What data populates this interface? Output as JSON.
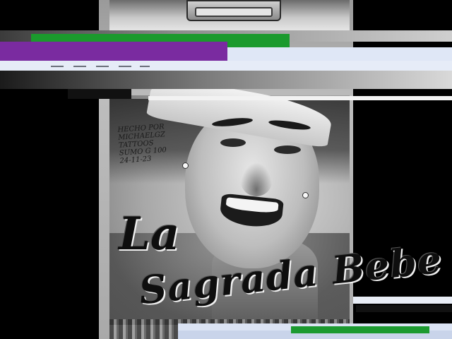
{
  "drawing": {
    "signature_text": "HECHO POR\nMICHAELGZ\nTATTOOS\nSUMO G 100\n24-11-23",
    "script_title": "La",
    "script_name": "Sagrada Bebe"
  },
  "colors": {
    "glitch_green": "#1b9a2d",
    "glitch_purple": "#7a2ba0",
    "glitch_light": "#dfe7f6",
    "background": "#000000"
  }
}
